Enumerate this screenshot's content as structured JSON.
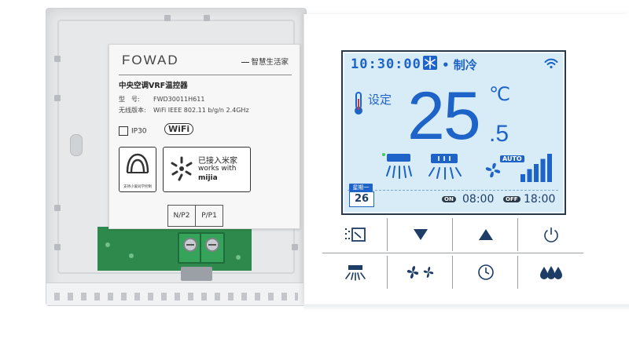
{
  "label": {
    "brand": "FOWAD",
    "slogan": "智慧生活家",
    "product_name": "中央空调VRF温控器",
    "model_key": "型　号:",
    "model_value": "FWD30011H611",
    "wireless_key": "无线版本:",
    "wireless_value": "WiFi IEEE 802.11 b/g/n 2.4GHz",
    "ip_rating": "IP30",
    "wifi_badge": "WiFi",
    "logo_caption": "支持小爱同学控制",
    "mijia_line1": "已接入米家",
    "mijia_line2": "works with",
    "mijia_line3": "mijia",
    "terminal_1": "N/P2",
    "terminal_2": "P/P1"
  },
  "screen": {
    "time": "10:30:00",
    "mode_icon": "snowflake-icon",
    "mode": "• 制冷",
    "set_label": "设定",
    "temperature_int": "25",
    "temperature_dec": ".5",
    "unit": "℃",
    "auto_label": "AUTO",
    "fan_level_bars": 5,
    "fan_level_of": 5,
    "weekday_label": "星期一",
    "day": "26",
    "on_label": "ON",
    "on_time": "08:00",
    "off_label": "OFF",
    "off_time": "18:00",
    "accent": "#1d63c8",
    "screen_bg": "#d8ecf8"
  },
  "keys": [
    {
      "name": "mode-key",
      "icon": "mode-icon"
    },
    {
      "name": "temp-down-key",
      "icon": "triangle-down-icon"
    },
    {
      "name": "temp-up-key",
      "icon": "triangle-up-icon"
    },
    {
      "name": "power-key",
      "icon": "power-icon"
    },
    {
      "name": "swing-key",
      "icon": "swing-icon"
    },
    {
      "name": "fan-speed-key",
      "icon": "fan-icon"
    },
    {
      "name": "timer-key",
      "icon": "clock-icon"
    },
    {
      "name": "dehumidify-key",
      "icon": "droplets-icon"
    }
  ]
}
